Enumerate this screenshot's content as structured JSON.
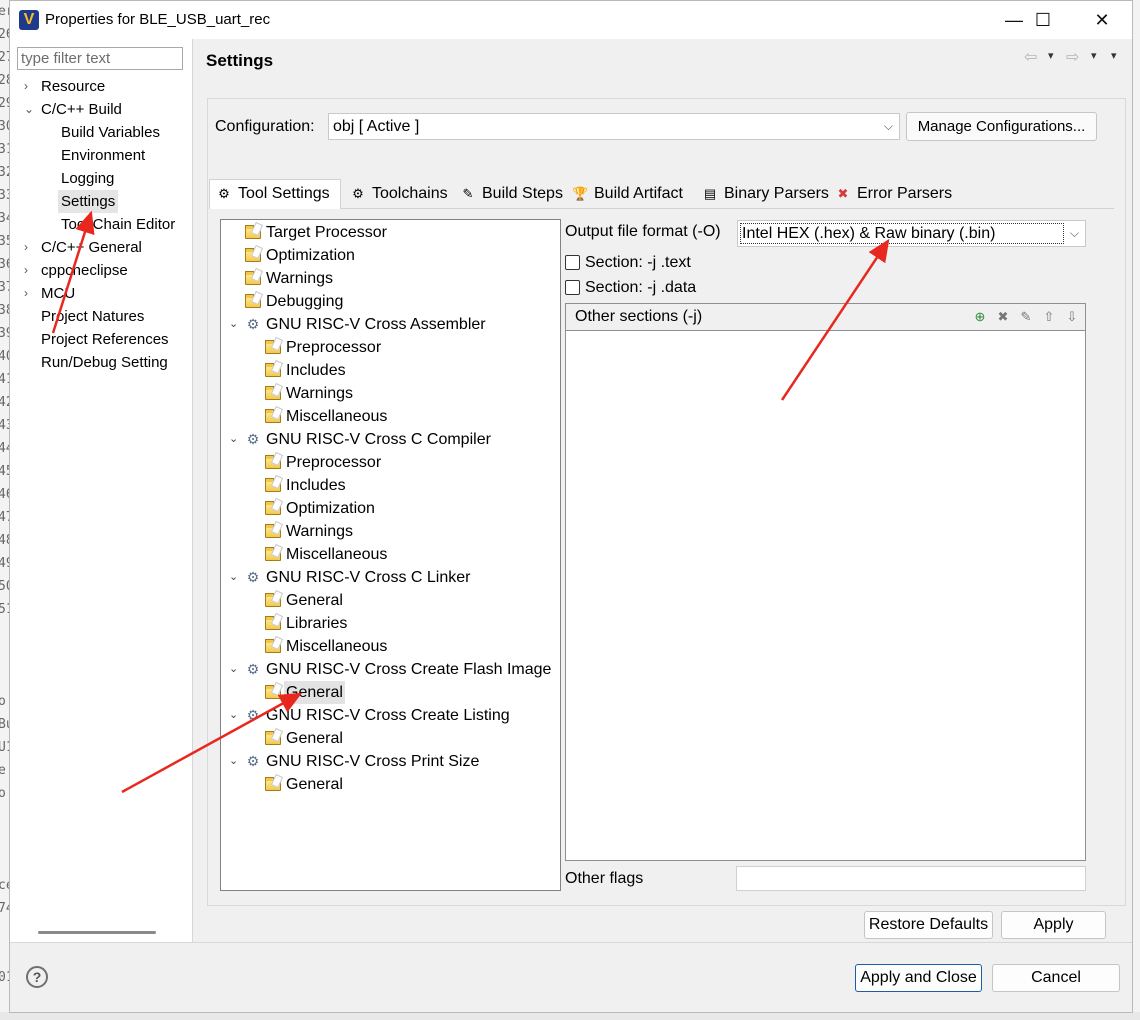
{
  "window": {
    "title": "Properties for BLE_USB_uart_rec",
    "minimize": "—",
    "maximize": "☐",
    "close": "✕"
  },
  "background_editor": {
    "lines": [
      "er",
      "26",
      "27",
      "28",
      "29",
      "30",
      "31",
      "32",
      "33",
      "34",
      "35",
      "36",
      "37",
      "38",
      "39",
      "40",
      "41",
      "42",
      "43",
      "44",
      "45",
      "46",
      "47",
      "48",
      "49",
      "50",
      "51",
      "",
      "",
      "",
      "o",
      "Bu",
      "U1",
      "e",
      "o:",
      "",
      "",
      "",
      "ce",
      "74",
      "",
      "",
      "01"
    ]
  },
  "nav": {
    "filter_placeholder": "type filter text",
    "items": [
      {
        "label": "Resource",
        "twisty": "›"
      },
      {
        "label": "C/C++ Build",
        "twisty": "⌄"
      },
      {
        "label": "Build Variables",
        "twisty": ""
      },
      {
        "label": "Environment",
        "twisty": ""
      },
      {
        "label": "Logging",
        "twisty": ""
      },
      {
        "label": "Settings",
        "twisty": ""
      },
      {
        "label": "Tool Chain Editor",
        "twisty": ""
      },
      {
        "label": "C/C++ General",
        "twisty": "›"
      },
      {
        "label": "cppcheclipse",
        "twisty": "›"
      },
      {
        "label": "MCU",
        "twisty": "›"
      },
      {
        "label": "Project Natures",
        "twisty": ""
      },
      {
        "label": "Project References",
        "twisty": ""
      },
      {
        "label": "Run/Debug Setting",
        "twisty": ""
      }
    ]
  },
  "header": {
    "title": "Settings",
    "back": "⇦",
    "forward": "⇨",
    "caret": "▾"
  },
  "configuration": {
    "label": "Configuration:",
    "value": "obj  [ Active ]",
    "manage_button": "Manage Configurations..."
  },
  "tabs": [
    {
      "label": "Tool Settings",
      "icon": "⚙"
    },
    {
      "label": "Toolchains",
      "icon": "⚙"
    },
    {
      "label": "Build Steps",
      "icon": "✎"
    },
    {
      "label": "Build Artifact",
      "icon": "🏆"
    },
    {
      "label": "Binary Parsers",
      "icon": "▤"
    },
    {
      "label": "Error Parsers",
      "icon": "✖"
    }
  ],
  "tool_tree": [
    {
      "label": "Target Processor"
    },
    {
      "label": "Optimization"
    },
    {
      "label": "Warnings"
    },
    {
      "label": "Debugging"
    },
    {
      "label": "GNU RISC-V Cross Assembler"
    },
    {
      "label": "Preprocessor"
    },
    {
      "label": "Includes"
    },
    {
      "label": "Warnings"
    },
    {
      "label": "Miscellaneous"
    },
    {
      "label": "GNU RISC-V Cross C Compiler"
    },
    {
      "label": "Preprocessor"
    },
    {
      "label": "Includes"
    },
    {
      "label": "Optimization"
    },
    {
      "label": "Warnings"
    },
    {
      "label": "Miscellaneous"
    },
    {
      "label": "GNU RISC-V Cross C Linker"
    },
    {
      "label": "General"
    },
    {
      "label": "Libraries"
    },
    {
      "label": "Miscellaneous"
    },
    {
      "label": "GNU RISC-V Cross Create Flash Image"
    },
    {
      "label": "General"
    },
    {
      "label": "GNU RISC-V Cross Create Listing"
    },
    {
      "label": "General"
    },
    {
      "label": "GNU RISC-V Cross Print Size"
    },
    {
      "label": "General"
    }
  ],
  "options": {
    "output_format_label": "Output file format (-O)",
    "output_format_value": "Intel HEX (.hex) & Raw binary (.bin)",
    "section_text": "Section: -j .text",
    "section_data": "Section: -j .data",
    "section_text_checked": false,
    "section_data_checked": false,
    "other_sections_title": "Other sections (-j)",
    "other_flags_label": "Other flags",
    "other_flags_value": ""
  },
  "buttons": {
    "restore_defaults": "Restore Defaults",
    "apply": "Apply",
    "apply_and_close": "Apply and Close",
    "cancel": "Cancel",
    "help": "?"
  },
  "annotation_color": "#e8281f"
}
